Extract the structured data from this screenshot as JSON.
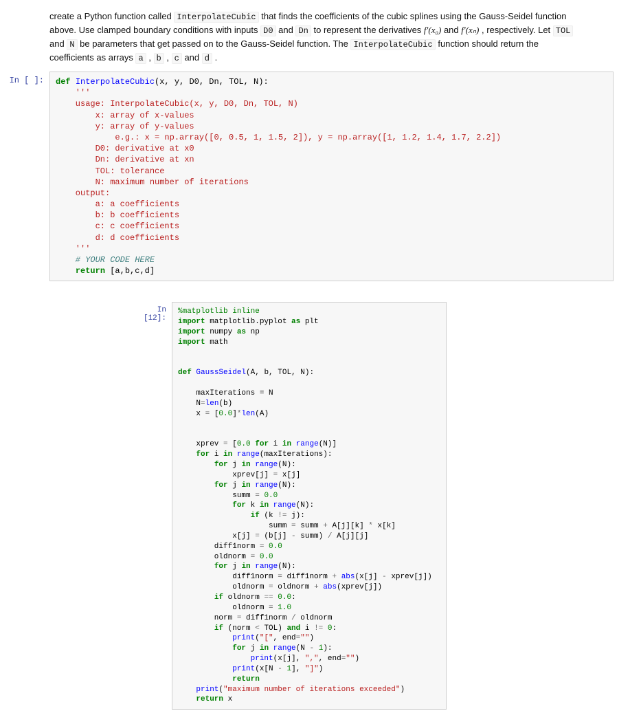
{
  "instructions": {
    "pre": "create a Python function called ",
    "fn": "InterpolateCubic",
    "mid1": " that finds the coefficients of the cubic splines using the Gauss-Seidel function above. Use clamped boundary conditions with inputs ",
    "d0": "D0",
    "mid2": " and ",
    "dn": "Dn",
    "mid3": " to represent the derivatives ",
    "fx0": "f′(x₀)",
    "mid4": " and ",
    "fxn": "f′(xₙ)",
    "mid5": ", respectively. Let ",
    "tol": "TOL",
    "mid6": " and ",
    "nvar": "N",
    "mid7": " be parameters that get passed on to the Gauss-Seidel function. The ",
    "fn2": "InterpolateCubic",
    "mid8": " function should return the coefficients as arrays ",
    "a": "a",
    "c1": " , ",
    "b": "b",
    "c2": " , ",
    "c": "c",
    "c3": " and ",
    "d": "d",
    "end": " ."
  },
  "cell1": {
    "prompt": "In [ ]:",
    "line1_def": "def",
    "line1_name": "InterpolateCubic",
    "line1_args": "(x, y, D0, Dn, TOL, N):",
    "doc_open": "    '''",
    "doc1": "    usage: InterpolateCubic(x, y, D0, Dn, TOL, N)",
    "doc2": "        x: array of x-values",
    "doc3": "        y: array of y-values",
    "doc4": "            e.g.: x = np.array([0, 0.5, 1, 1.5, 2]), y = np.array([1, 1.2, 1.4, 1.7, 2.2])",
    "doc5": "        D0: derivative at x0",
    "doc6": "        Dn: derivative at xn",
    "doc7": "        TOL: tolerance",
    "doc8": "        N: maximum number of iterations",
    "doc9": "    output:",
    "doc10": "        a: a coefficients",
    "doc11": "        b: b coefficients",
    "doc12": "        c: c coefficients",
    "doc13": "        d: d coefficients",
    "doc_close": "    '''",
    "cmt": "    # YOUR CODE HERE",
    "ret_kw": "return",
    "ret_val": "[a,b,c,d]"
  },
  "cell2": {
    "prompt": "In [12]:",
    "magic": "%matplotlib inline",
    "imp": "import",
    "as": "as",
    "mpl": " matplotlib.pyplot ",
    "plt": " plt",
    "npmod": " numpy ",
    "np": " np",
    "math": " math",
    "def": "def",
    "gs": "GaussSeidel",
    "gsargs": "(A, b, TOL, N):",
    "l_maxiter": "    maxIterations = N",
    "l_nlen_a": "    N",
    "l_nlen_b": "len",
    "l_nlen_c": "(b)",
    "l_xinit_a": "    x ",
    "l_xinit_eq": "=",
    "l_xinit_b": " [",
    "l_xinit_n": "0.0",
    "l_xinit_c": "]",
    "l_xinit_op": "*",
    "l_xinit_len": "len",
    "l_xinit_d": "(A)",
    "l_xprev_a": "    xprev ",
    "l_xprev_b": " [",
    "l_xprev_n": "0.0",
    "l_xprev_for": "for",
    "l_xprev_i": " i ",
    "l_xprev_in": "in",
    "l_xprev_rng": "range",
    "l_xprev_c": "(N)]",
    "for": "for",
    "in": "in",
    "range": "range",
    "if": "if",
    "and": "and",
    "return": "return",
    "print": "print",
    "abs": "abs",
    "l_foriter": " i ",
    "l_foriter2": "(maxIterations):",
    "l_forj": " j ",
    "l_forjN": "(N):",
    "l_xprevassign": "            xprev[j] ",
    "l_xprevassign2": " x[j]",
    "l_summ0a": "            summ ",
    "l_summ0n": "0.0",
    "l_fork": " k ",
    "l_forkN": "(N):",
    "l_ifk_a": " (k ",
    "l_ifk_op": "!=",
    "l_ifk_b": " j):",
    "l_summupd_a": "                    summ ",
    "l_summupd_b": " summ ",
    "l_summupd_c": " A[j][k] ",
    "l_summupd_d": " x[k]",
    "plus": "+",
    "minus": "-",
    "star": "*",
    "slash": "/",
    "eq": "=",
    "eqeq": "==",
    "lt": "<",
    "neq": "!=",
    "l_xj_a": "            x[j] ",
    "l_xj_b": " (b[j] ",
    "l_xj_c": " summ) ",
    "l_xj_d": " A[j][j]",
    "l_d1_a": "        diff1norm ",
    "l_d1_n": "0.0",
    "l_old_a": "        oldnorm ",
    "l_old_n": "0.0",
    "l_d1upd_a": "            diff1norm ",
    "l_d1upd_b": " diff1norm ",
    "l_d1upd_c": "(x[j] ",
    "l_d1upd_d": " xprev[j])",
    "l_oldupd_a": "            oldnorm ",
    "l_oldupd_b": " oldnorm ",
    "l_oldupd_c": "(xprev[j])",
    "l_ifold_a": " oldnorm ",
    "l_ifold_n": "0.0",
    "l_ifold_c": ":",
    "l_oldset_a": "            oldnorm ",
    "l_oldset_n": "1.0",
    "l_norm_a": "        norm ",
    "l_norm_b": " diff1norm ",
    "l_norm_c": " oldnorm",
    "l_ifnorm_a": " (norm ",
    "l_ifnorm_b": " TOL) ",
    "l_ifnorm_c": " i ",
    "l_ifnorm_n": "0",
    "l_ifnorm_d": ":",
    "l_pr1_a": "(",
    "l_pr1_s": "\"[\"",
    "l_pr1_b": ", end",
    "l_pr1_c": "\"\"",
    "l_pr1_d": ")",
    "l_forj2": " j ",
    "l_forj2N_a": "(N ",
    "l_forj2N_n": "1",
    "l_forj2N_b": "):",
    "l_pr2_a": "(x[j], ",
    "l_pr2_s": "\",\"",
    "l_pr2_b": ", end",
    "l_pr2_c": "\"\"",
    "l_pr2_d": ")",
    "l_pr3_a": "(x[N ",
    "l_pr3_n": "1",
    "l_pr3_b": "], ",
    "l_pr3_s": "\"]\"",
    "l_pr3_c": ")",
    "l_prmax_a": "(",
    "l_prmax_s": "\"maximum number of iterations exceeded\"",
    "l_prmax_b": ")",
    "l_retx": " x"
  }
}
